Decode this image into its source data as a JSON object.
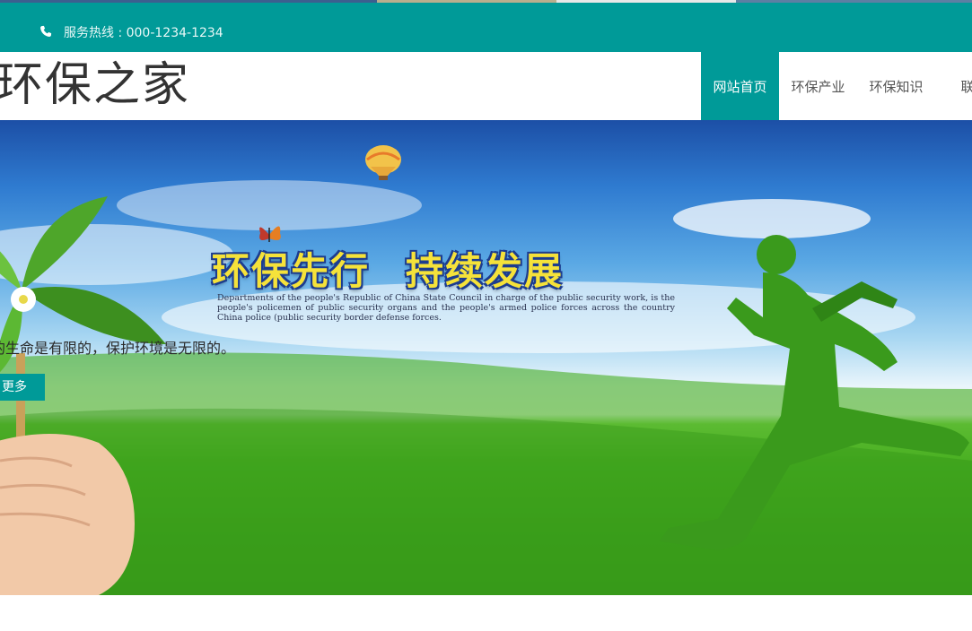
{
  "topbar": {
    "hotline_label": "服务热线 : 000-1234-1234",
    "icon": "phone-icon"
  },
  "header": {
    "site_title": "环保之家"
  },
  "nav": {
    "items": [
      {
        "label": "网站首页",
        "active": true
      },
      {
        "label": "环保产业",
        "active": false
      },
      {
        "label": "环保知识",
        "active": false
      },
      {
        "label": "联系",
        "active": false
      }
    ]
  },
  "banner": {
    "slogan_left": "环保先行",
    "slogan_right": "持续发展",
    "slogan_sub": "Departments of the people's Republic of China State Council in charge of the public security work, is the people's policemen of public security organs and the people's armed police forces across the country China police (public security border defense forces.",
    "caption": "的生命是有限的，保护环境是无限的。",
    "more_label": "更多"
  },
  "colors": {
    "accent": "#009a98",
    "text_dark": "#333333",
    "nav_text": "#555555"
  }
}
